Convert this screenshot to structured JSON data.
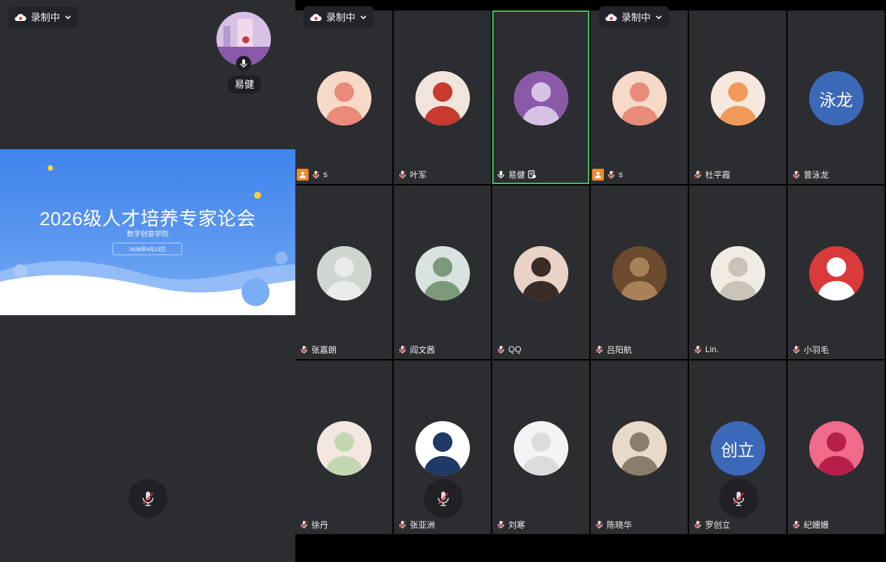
{
  "recording": {
    "label": "录制中"
  },
  "speaker": {
    "name": "易健"
  },
  "slide": {
    "title": "2026级人才培养专家论会",
    "subtitle": "数字创意学院",
    "date": "2026年4月13日"
  },
  "participants": [
    {
      "name": "s",
      "host": true
    },
    {
      "name": "叶军"
    },
    {
      "name": "易健",
      "active": true
    },
    {
      "name": "s",
      "host": true
    },
    {
      "name": "杜平霞"
    },
    {
      "name": "曾泳龙",
      "avatar_text": "泳龙"
    },
    {
      "name": "张嘉朗"
    },
    {
      "name": "阎文茜"
    },
    {
      "name": "QQ"
    },
    {
      "name": "吕阳航"
    },
    {
      "name": "Lin."
    },
    {
      "name": "小羽毛"
    },
    {
      "name": "徐丹"
    },
    {
      "name": "张亚洲"
    },
    {
      "name": "刘寒"
    },
    {
      "name": "陈晓华"
    },
    {
      "name": "罗创立",
      "avatar_text": "创立"
    },
    {
      "name": "纪姗姗"
    }
  ],
  "colors": {
    "active_border": "#38c25f",
    "host_badge": "#f08a2c",
    "avatar_text_bg": "#3c68b8",
    "tile_bg": "#2c2d31"
  }
}
